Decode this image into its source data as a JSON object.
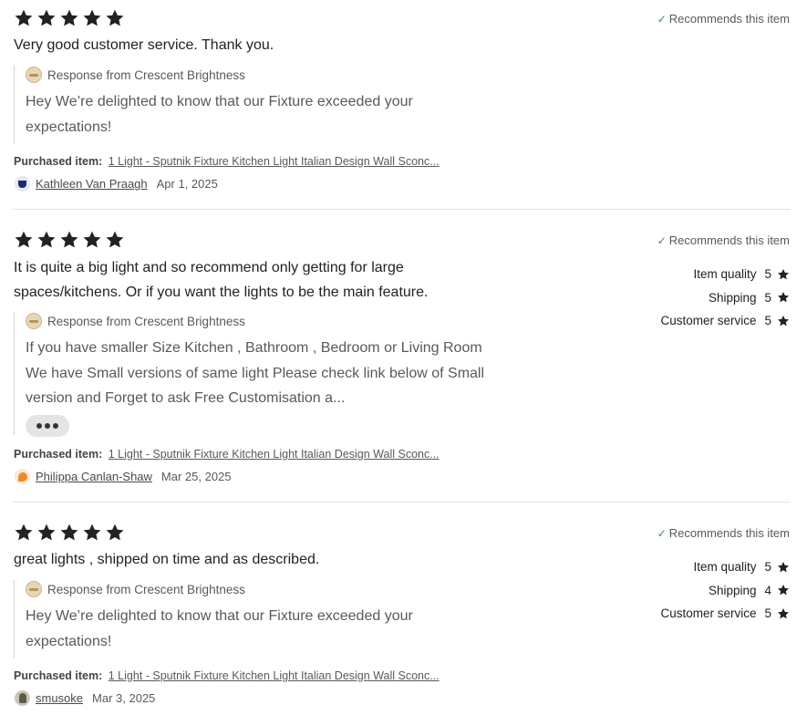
{
  "reviews": [
    {
      "stars": 5,
      "recommends": "Recommends this item",
      "text": "Very good customer service. Thank you.",
      "response_label": "Response from Crescent Brightness",
      "response_text": "Hey We’re delighted to know that our Fixture exceeded your expectations!",
      "purchased_label": "Purchased item:",
      "purchased_item": "1 Light - Sputnik Fixture Kitchen Light Italian Design Wall Sconc...",
      "reviewer": "Kathleen Van Praagh",
      "date": "Apr 1, 2025"
    },
    {
      "stars": 5,
      "recommends": "Recommends this item",
      "text": "It is quite a big light and so recommend only getting for large spaces/kitchens. Or if you want the lights to be the main feature.",
      "response_label": "Response from Crescent Brightness",
      "response_text": "If you have smaller Size Kitchen , Bathroom , Bedroom or Living Room We have Small versions of same light Please check link below of Small version and Forget to ask Free Customisation a...",
      "purchased_label": "Purchased item:",
      "purchased_item": "1 Light - Sputnik Fixture Kitchen Light Italian Design Wall Sconc...",
      "reviewer": "Philippa Canlan-Shaw",
      "date": "Mar 25, 2025",
      "ratings": [
        {
          "label": "Item quality",
          "value": "5"
        },
        {
          "label": "Shipping",
          "value": "5"
        },
        {
          "label": "Customer service",
          "value": "5"
        }
      ]
    },
    {
      "stars": 5,
      "recommends": "Recommends this item",
      "text": "great lights , shipped on time and as described.",
      "response_label": "Response from Crescent Brightness",
      "response_text": "Hey We’re delighted to know that our Fixture exceeded your expectations!",
      "purchased_label": "Purchased item:",
      "purchased_item": "1 Light - Sputnik Fixture Kitchen Light Italian Design Wall Sconc...",
      "reviewer": "smusoke",
      "date": "Mar 3, 2025",
      "ratings": [
        {
          "label": "Item quality",
          "value": "5"
        },
        {
          "label": "Shipping",
          "value": "4"
        },
        {
          "label": "Customer service",
          "value": "5"
        }
      ]
    }
  ],
  "colors": {
    "star": "#222222",
    "check": "#3c8a5a",
    "muted_text": "#595959"
  },
  "icons": {
    "star": "star-icon",
    "check": "check-icon",
    "more": "more-options-icon"
  }
}
